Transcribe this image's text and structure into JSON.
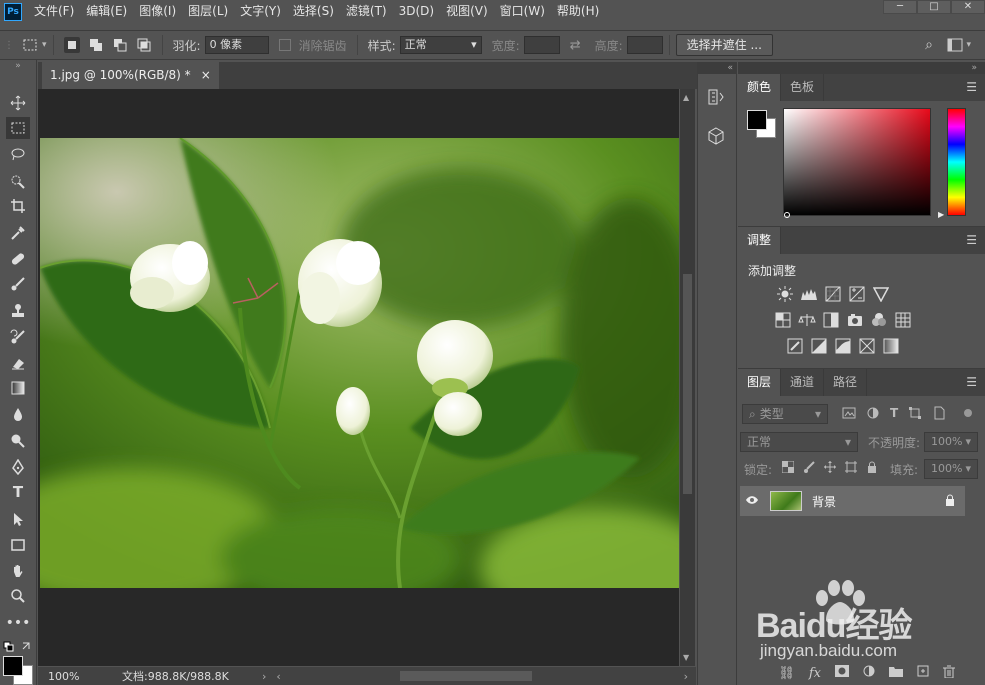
{
  "app": {
    "logo": "Ps"
  },
  "menu": [
    "文件(F)",
    "编辑(E)",
    "图像(I)",
    "图层(L)",
    "文字(Y)",
    "选择(S)",
    "滤镜(T)",
    "3D(D)",
    "视图(V)",
    "窗口(W)",
    "帮助(H)"
  ],
  "window_controls": {
    "minimize": "─",
    "maximize": "□",
    "close": "✕"
  },
  "options": {
    "feather_label": "羽化:",
    "feather_value": "0 像素",
    "antialias_label": "消除锯齿",
    "style_label": "样式:",
    "style_value": "正常",
    "width_label": "宽度:",
    "height_label": "高度:",
    "select_mask_button": "选择并遮住 ..."
  },
  "document": {
    "tab_title": "1.jpg @ 100%(RGB/8) *",
    "tab_close": "×"
  },
  "status": {
    "zoom": "100%",
    "doc_info": "文档:988.8K/988.8K"
  },
  "color_panel": {
    "tabs": [
      "颜色",
      "色板"
    ],
    "foreground_color": "#000000",
    "background_color": "#ffffff"
  },
  "adjustments_panel": {
    "tab": "调整",
    "heading": "添加调整"
  },
  "layers_panel": {
    "tabs": [
      "图层",
      "通道",
      "路径"
    ],
    "filter_kind": "类型",
    "blend_mode": "正常",
    "opacity_label": "不透明度:",
    "opacity_value": "100%",
    "lock_label": "锁定:",
    "fill_label": "填充:",
    "fill_value": "100%",
    "layers": [
      {
        "name": "背景",
        "visible": true,
        "locked": true
      }
    ]
  },
  "watermark": {
    "brand": "Baidu经验",
    "url": "jingyan.baidu.com"
  },
  "colors": {
    "ui_bg": "#535353",
    "panel_dark": "#424242",
    "canvas_bg": "#282828",
    "accent": "#31a8ff"
  }
}
